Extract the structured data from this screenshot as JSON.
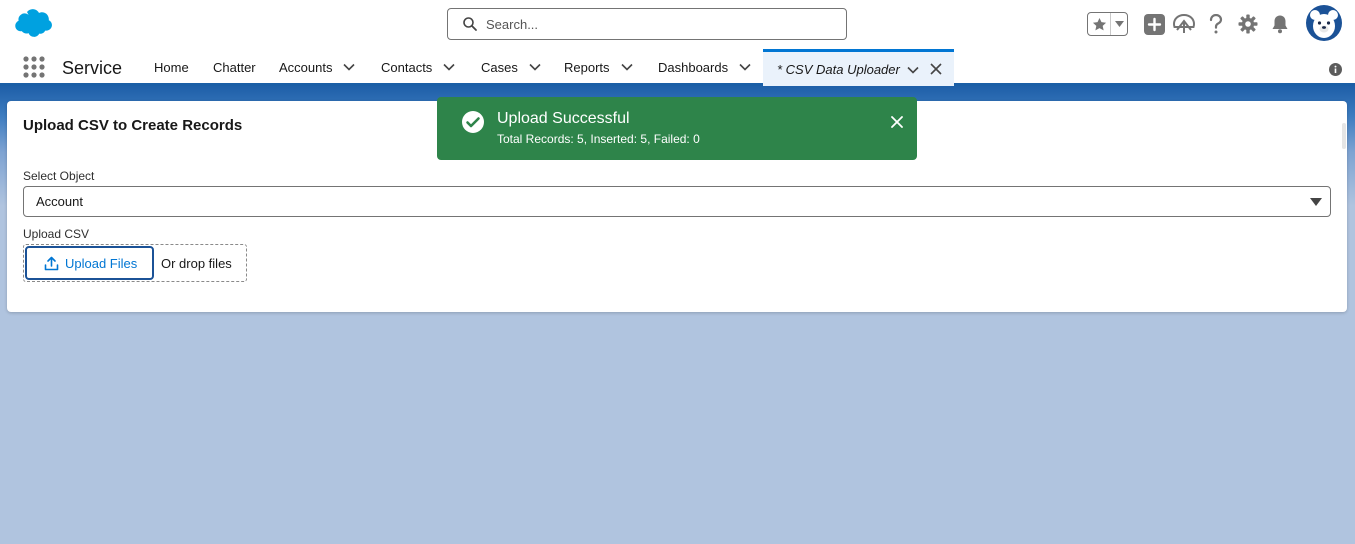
{
  "header": {
    "search_placeholder": "Search..."
  },
  "nav": {
    "app_name": "Service",
    "items": [
      {
        "label": "Home"
      },
      {
        "label": "Chatter"
      },
      {
        "label": "Accounts"
      },
      {
        "label": "Contacts"
      },
      {
        "label": "Cases"
      },
      {
        "label": "Reports"
      },
      {
        "label": "Dashboards"
      }
    ],
    "active_tab": {
      "label": "* CSV Data Uploader"
    }
  },
  "card": {
    "title": "Upload CSV to Create Records",
    "select_label": "Select Object",
    "select_value": "Account",
    "upload_label": "Upload CSV",
    "upload_button": "Upload Files",
    "drop_text": "Or drop files"
  },
  "toast": {
    "title": "Upload Successful",
    "message": "Total Records: 5, Inserted: 5, Failed: 0"
  },
  "colors": {
    "brand_blue": "#0176d3",
    "toast_green": "#2e844a",
    "background": "#b0c4df"
  }
}
